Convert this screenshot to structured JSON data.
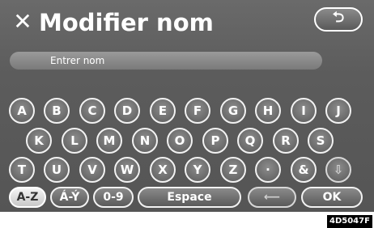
{
  "header": {
    "title_icon": "✕",
    "title": "Modifier nom",
    "back_icon": "⮌"
  },
  "name_field": {
    "value": "",
    "placeholder": "Entrer nom"
  },
  "keyboard": {
    "rows": [
      [
        "A",
        "B",
        "C",
        "D",
        "E",
        "F",
        "G",
        "H",
        "I",
        "J"
      ],
      [
        "K",
        "L",
        "M",
        "N",
        "O",
        "P",
        "Q",
        "R",
        "S"
      ],
      [
        "T",
        "U",
        "V",
        "W",
        "X",
        "Y",
        "Z",
        "·",
        "&",
        "⇩"
      ]
    ],
    "bottom_row": {
      "az_label": "A-Z",
      "accent_label": "Á-Ý",
      "digits_label": "0-9",
      "space_label": "Espace",
      "delete_label": "⟵",
      "ok_label": "OK"
    }
  },
  "footer": {
    "code": "4D5047F"
  }
}
